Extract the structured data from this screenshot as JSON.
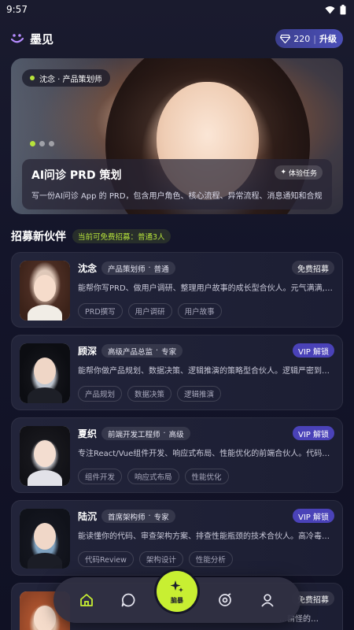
{
  "status_bar": {
    "time": "9:57"
  },
  "header": {
    "app_name": "墨见",
    "coins": "220",
    "upgrade_label": "升级"
  },
  "hero": {
    "tag": "沈念 · 产品策划师",
    "title": "AI问诊 PRD 策划",
    "description": "写一份AI问诊 App 的 PRD，包含用户角色、核心流程、异常流程、消息通知和合规要求。",
    "badge": "体验任务",
    "page_count": 3,
    "active_page": 1
  },
  "section": {
    "title": "招募新伙伴",
    "quota": "当前可免费招募：普通3人"
  },
  "partners": [
    {
      "name": "沈念",
      "role": "产品策划师",
      "level": "普通",
      "recruit": "免费招募",
      "recruit_type": "free",
      "desc": "能帮你写PRD、做用户调研、整理用户故事的成长型合伙人。元气满满,…",
      "skills": [
        "PRD撰写",
        "用户调研",
        "用户故事"
      ]
    },
    {
      "name": "顾深",
      "role": "高级产品总监",
      "level": "专家",
      "recruit": "VIP 解锁",
      "recruit_type": "vip",
      "desc": "能帮你做产品规划、数据决策、逻辑推演的策略型合伙人。逻辑严密到…",
      "skills": [
        "产品规划",
        "数据决策",
        "逻辑推演"
      ]
    },
    {
      "name": "夏织",
      "role": "前端开发工程师",
      "level": "高级",
      "recruit": "VIP 解锁",
      "recruit_type": "vip",
      "desc": "专注React/Vue组件开发、响应式布局、性能优化的前端合伙人。代码和…",
      "skills": [
        "组件开发",
        "响应式布局",
        "性能优化"
      ]
    },
    {
      "name": "陆沉",
      "role": "首席架构师",
      "level": "专家",
      "recruit": "VIP 解锁",
      "recruit_type": "vip",
      "desc": "能读懂你的代码、审查架构方案、排查性能瓶颈的技术合伙人。高冷毒…",
      "skills": [
        "代码Review",
        "架构设计",
        "性能分析"
      ]
    },
    {
      "name": "",
      "role": "",
      "level": "",
      "recruit": "免费招募",
      "recruit_type": "free",
      "desc": "…精怪的…",
      "skills": []
    }
  ],
  "nav": {
    "center_label": "脑暴"
  },
  "colors": {
    "accent": "#c8ef32",
    "vip": "#4a42b8",
    "brand": "#b68cff"
  }
}
